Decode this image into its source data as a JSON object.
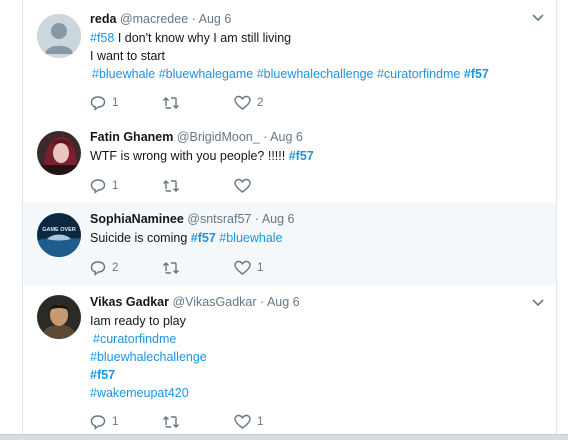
{
  "tweets": [
    {
      "name": "reda",
      "handle": "@macredee",
      "separator": "·",
      "date": "Aug 6",
      "line1_tag": "#f58",
      "line1_text": " I don't know why I am still living",
      "line2_text": "I want to start",
      "line3_tags": [
        "#bluewhale",
        "#bluewhalegame",
        "#bluewhalechallenge",
        "#curatorfindme",
        "#f57"
      ],
      "reply_count": "1",
      "retweet_count": "",
      "like_count": "2",
      "avatar_icon": "default-avatar-icon"
    },
    {
      "name": "Fatin Ghanem",
      "handle": "@BrigidMoon_",
      "separator": "·",
      "date": "Aug 6",
      "text": "WTF is wrong with you people? !!!!! ",
      "tag": "#f57",
      "reply_count": "1",
      "retweet_count": "",
      "like_count": ""
    },
    {
      "name": "SophiaNaminee",
      "handle": "@sntsraf57",
      "separator": "·",
      "date": "Aug 6",
      "text": "Suicide is coming ",
      "tag1": "#f57",
      "tag2": "#bluewhale",
      "reply_count": "2",
      "retweet_count": "",
      "like_count": "1",
      "avatar_text": "GAME OVER"
    },
    {
      "name": "Vikas Gadkar",
      "handle": "@VikasGadkar",
      "separator": "·",
      "date": "Aug 6",
      "text": "Iam ready to play",
      "tags": [
        "#curatorfindme",
        "#bluewhalechallenge",
        "#f57",
        "#wakemeupat420"
      ],
      "reply_count": "1",
      "retweet_count": "",
      "like_count": "1"
    }
  ],
  "colors": {
    "link": "#1b95e0",
    "muted": "#657786",
    "highlight_bg": "#f5f8fa",
    "border": "#e6ecf0"
  },
  "icons": [
    "reply-icon",
    "retweet-icon",
    "like-icon",
    "caret-down-icon"
  ]
}
